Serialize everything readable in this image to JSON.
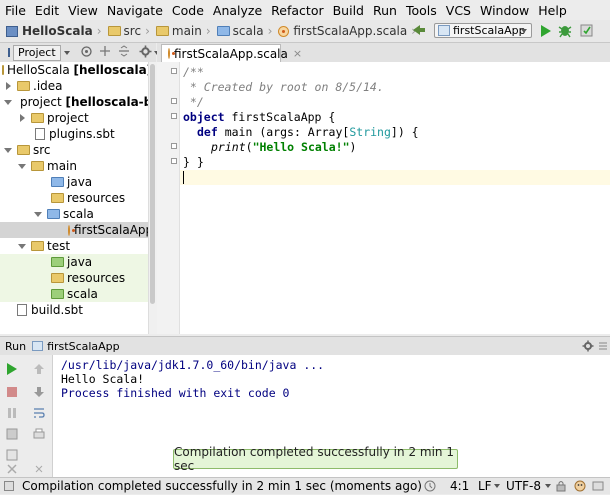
{
  "menu": [
    "File",
    "Edit",
    "View",
    "Navigate",
    "Code",
    "Analyze",
    "Refactor",
    "Build",
    "Run",
    "Tools",
    "VCS",
    "Window",
    "Help"
  ],
  "breadcrumbs": {
    "project": "HelloScala",
    "src": "src",
    "main": "main",
    "scala": "scala",
    "file": "firstScalaApp.scala"
  },
  "run_config": "firstScalaApp",
  "project_panel": {
    "tab": "Project"
  },
  "tree": [
    {
      "label": "HelloScala",
      "suffix": "[helloscala]"
    },
    {
      "label": ".idea"
    },
    {
      "label": "project",
      "suffix": "[helloscala-b"
    },
    {
      "label": "project"
    },
    {
      "label": "plugins.sbt"
    },
    {
      "label": "src"
    },
    {
      "label": "main"
    },
    {
      "label": "java"
    },
    {
      "label": "resources"
    },
    {
      "label": "scala"
    },
    {
      "label": "firstScalaApp"
    },
    {
      "label": "test"
    },
    {
      "label": "java"
    },
    {
      "label": "resources"
    },
    {
      "label": "scala"
    },
    {
      "label": "build.sbt"
    }
  ],
  "editor": {
    "tab": "firstScalaApp.scala",
    "lines": {
      "c1": "/**",
      "c2": " * Created by root on 8/5/14.",
      "c3": " */",
      "obj_kw": "object",
      "obj_name": " firstScalaApp {",
      "def_kw": "def",
      "def_rest1": " main (args: Array[",
      "def_type": "String",
      "def_rest2": "]) {",
      "print_fn": "print",
      "print_open": "(",
      "print_str": "\"Hello Scala!\"",
      "print_close": ")",
      "close1": "}",
      "close2": "}"
    }
  },
  "run": {
    "label": "Run",
    "tab": "firstScalaApp",
    "console": [
      "/usr/lib/java/jdk1.7.0_60/bin/java ...",
      "Hello Scala!",
      "Process finished with exit code 0"
    ]
  },
  "balloon": "Compilation completed successfully in 2 min 1 sec",
  "status": {
    "message": "Compilation completed successfully in 2 min 1 sec (moments ago)",
    "position": "4:1",
    "line_sep": "LF",
    "encoding": "UTF-8"
  },
  "colors": {
    "console_path": "#000080",
    "run_green": "#2fa52f",
    "stop_red": "#cc2222"
  }
}
